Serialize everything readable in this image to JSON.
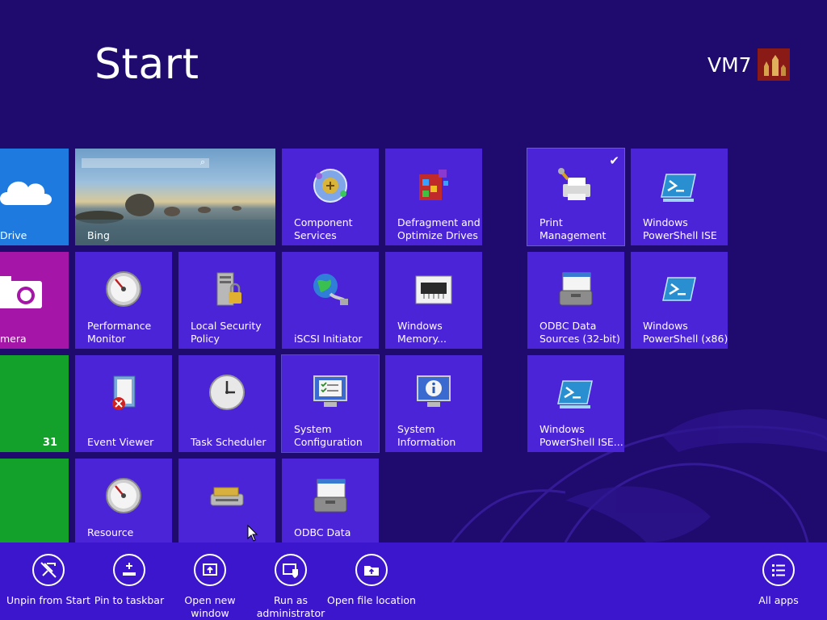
{
  "screen": {
    "title": "Start",
    "user_name": "VM7"
  },
  "tiles": {
    "skydrive": "Drive",
    "camera": "mera",
    "calendar_day": "31",
    "bing": "Bing",
    "component_services": "Component Services",
    "defragment": "Defragment and Optimize Drives",
    "print_management": "Print Management",
    "powershell_ise": "Windows PowerShell ISE",
    "performance_monitor": "Performance Monitor",
    "local_security_policy": "Local Security Policy",
    "iscsi_initiator": "iSCSI Initiator",
    "windows_memory": "Windows Memory...",
    "odbc_32": "ODBC Data Sources (32-bit)",
    "powershell_x86": "Windows PowerShell (x86)",
    "event_viewer": "Event Viewer",
    "task_scheduler": "Task Scheduler",
    "system_configuration": "System Configuration",
    "system_information": "System Information",
    "powershell_ise_x86": "Windows PowerShell ISE...",
    "resource_monitor": "Resource",
    "odbc_data": "ODBC Data"
  },
  "appbar": {
    "unpin": "Unpin from Start",
    "pin_taskbar": "Pin to taskbar",
    "open_new_window": "Open new window",
    "run_as_admin": "Run as administrator",
    "open_file_location": "Open file location",
    "all_apps": "All apps"
  },
  "colors": {
    "background": "#1f0a6e",
    "tile": "#4a24d6",
    "skydrive": "#1f7ae0",
    "camera": "#a515a8",
    "calendar": "#13a12c",
    "appbar": "#3b16cc"
  }
}
